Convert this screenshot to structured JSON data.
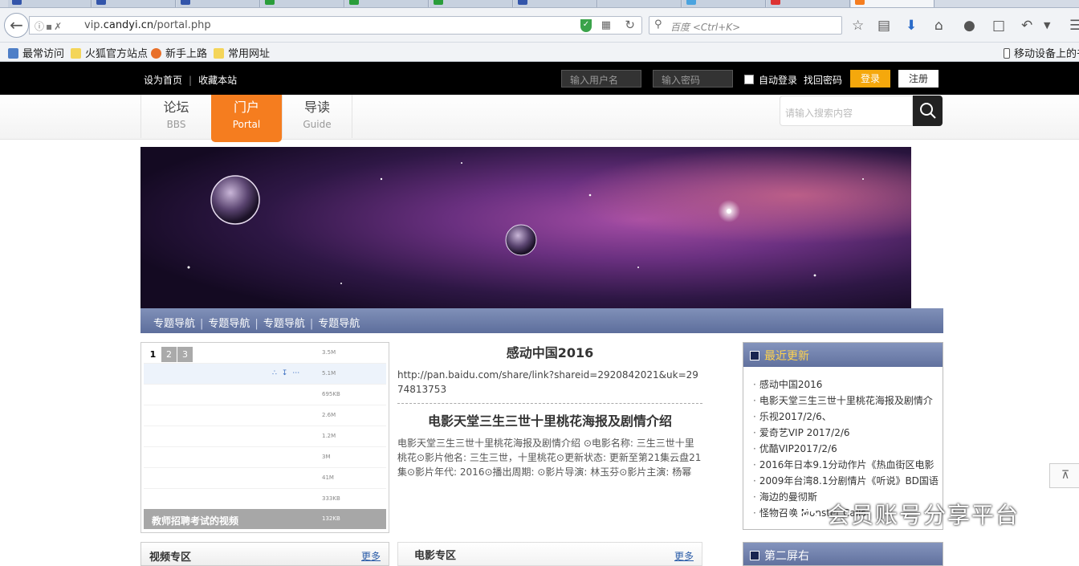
{
  "browser": {
    "url_prefix": "vip.",
    "url_host": "candyi.cn",
    "url_path": "/portal.php",
    "search_placeholder": "百度 <Ctrl+K>",
    "bookmarks": [
      "最常访问",
      "火狐官方站点",
      "新手上路",
      "常用网址"
    ],
    "mobile_bookmarks": "移动设备上的书"
  },
  "topbar": {
    "set_home": "设为首页",
    "bookmark_site": "收藏本站",
    "username_placeholder": "输入用户名",
    "password_placeholder": "输入密码",
    "auto_login": "自动登录",
    "find_password": "找回密码",
    "login": "登录",
    "register": "注册"
  },
  "mainnav": {
    "items": [
      {
        "cn": "论坛",
        "en": "BBS"
      },
      {
        "cn": "门户",
        "en": "Portal"
      },
      {
        "cn": "导读",
        "en": "Guide"
      }
    ],
    "search_placeholder": "请输入搜索内容"
  },
  "subnav": [
    "专题导航",
    "专题导航",
    "专题导航",
    "专题导航"
  ],
  "slider": {
    "pages": [
      "1",
      "2",
      "3"
    ],
    "sizes": [
      "3.5M",
      "5.1M",
      "695KB",
      "2.6M",
      "1.2M",
      "3M",
      "41M",
      "333KB"
    ],
    "caption": "教师招聘考试的视频",
    "caption_size": "132KB"
  },
  "article": {
    "title1": "感动中国2016",
    "link": "http://pan.baidu.com/share/link?shareid=2920842021&uk=2974813753",
    "title2": "电影天堂三生三世十里桃花海报及剧情介绍",
    "text": "电影天堂三生三世十里桃花海报及剧情介绍 ⊙电影名称: 三生三世十里桃花⊙影片他名: 三生三世，十里桃花⊙更新状态: 更新至第21集云盘21集⊙影片年代: 2016⊙播出周期: ⊙影片导演: 林玉芬⊙影片主演: 杨幂"
  },
  "latest": {
    "title": "最近更新",
    "items": [
      "感动中国2016",
      "电影天堂三生三世十里桃花海报及剧情介",
      "乐视2017/2/6、",
      "爱奇艺VIP 2017/2/6",
      "优酷VIP2017/2/6",
      "2016年日本9.1分动作片《热血街区电影",
      "2009年台湾8.1分剧情片《听说》BD国语",
      "海边的曼彻斯",
      "怪物召唤 Monster Calls"
    ]
  },
  "bottom": {
    "video_title": "视频专区",
    "movie_title": "电影专区",
    "more": "更多",
    "second_screen": "第二屏右"
  },
  "watermark": "会员账号分享平台",
  "colors": {
    "accent": "#f57d1f",
    "login": "#f5a80c",
    "subnav": "#6a7aa6"
  }
}
